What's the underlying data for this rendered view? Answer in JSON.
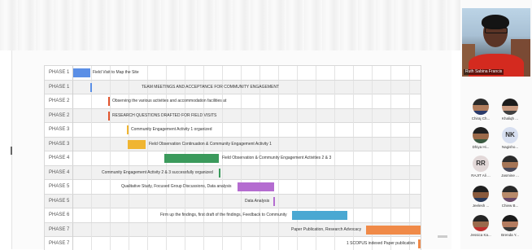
{
  "gantt": {
    "rows": [
      {
        "phase": "PHASE 1",
        "task": "Field Visit to Map the Site"
      },
      {
        "phase": "PHASE 1",
        "task": "TEAM MEETINGS AND ACCEPTANCE FOR COMMUNITY ENGAGEMENT"
      },
      {
        "phase": "PHASE 2",
        "task": "Observing the various activities and accommodation facilities at"
      },
      {
        "phase": "PHASE 2",
        "task": "RESEARCH QUESTIONS DRAFTED FOR FIELD VISITS"
      },
      {
        "phase": "PHASE 3",
        "task": "Community Engagement Activity 1 organized"
      },
      {
        "phase": "PHASE 3",
        "task": "Field Observation Continuation & Community Engagement Activity 1"
      },
      {
        "phase": "PHASE 4",
        "task": "Field Observation & Community Engagement Activities 2 & 3"
      },
      {
        "phase": "PHASE 4",
        "task": "Community Engagement Activity 2 & 3 successfully organized"
      },
      {
        "phase": "PHASE 5",
        "task": "Qualitative Study, Focused Group Discussions, Data analysis"
      },
      {
        "phase": "PHASE 5",
        "task": "Data Analysis"
      },
      {
        "phase": "PHASE 6",
        "task": "Firm up the findings, first draft of the findings, Feedback to Community"
      },
      {
        "phase": "PHASE 7",
        "task": "Paper Publication, Research Advocacy"
      },
      {
        "phase": "PHASE 7",
        "task": "1 SCOPUS indexed Paper publication"
      }
    ],
    "colors": {
      "phase1": "#5b8fe6",
      "phase2": "#e2552e",
      "phase3": "#f0b531",
      "phase4": "#3b9a5c",
      "phase5": "#b46cd0",
      "phase6": "#4aa8d2",
      "phase7": "#f08a48"
    }
  },
  "video": {
    "name": "Ruth Sabina Francis"
  },
  "participants": [
    {
      "name": "Chiraj Ch...",
      "initials": ""
    },
    {
      "name": "Khaliqh ...",
      "initials": ""
    },
    {
      "name": "Dhiya Hi...",
      "initials": ""
    },
    {
      "name": "Nagisho...",
      "initials": "NK"
    },
    {
      "name": "RAJIT Ali ...",
      "initials": "RR"
    },
    {
      "name": "Jasmine ...",
      "initials": ""
    },
    {
      "name": "Jeelesh ...",
      "initials": ""
    },
    {
      "name": "Chiew B...",
      "initials": ""
    },
    {
      "name": "Jessica Ka...",
      "initials": ""
    },
    {
      "name": "Brenda Y...",
      "initials": ""
    }
  ]
}
